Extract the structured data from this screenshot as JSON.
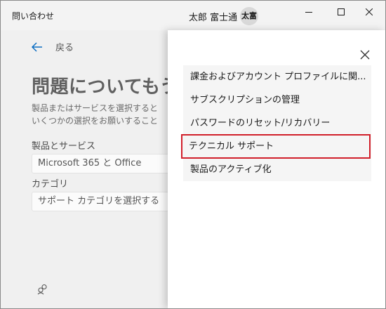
{
  "window": {
    "title": "問い合わせ",
    "user_name": "太郎 富士通",
    "avatar_initials": "太富"
  },
  "nav": {
    "back_label": "戻る"
  },
  "page": {
    "heading": "問題についてもう",
    "description_line1": "製品またはサービスを選択すると",
    "description_line2": "いくつかの選択をお願いすること",
    "product_label": "製品とサービス",
    "product_value": "Microsoft 365 と Office",
    "category_label": "カテゴリ",
    "category_placeholder": "サポート カテゴリを選択する"
  },
  "dropdown": {
    "items": [
      {
        "label": "課金およびアカウント プロファイルに関..."
      },
      {
        "label": "サブスクリプションの管理"
      },
      {
        "label": "パスワードのリセット/リカバリー"
      },
      {
        "label": "テクニカル サポート"
      },
      {
        "label": "製品のアクティブ化"
      }
    ],
    "highlighted_index": 3,
    "highlight_color": "#d11f2a"
  },
  "icons": {
    "back": "arrow-left-icon",
    "close_panel": "close-icon",
    "community": "community-icon",
    "minimize": "minimize-icon",
    "maximize": "maximize-icon",
    "close_window": "close-window-icon"
  },
  "colors": {
    "accent": "#0067c0",
    "panel_bg": "#ffffff",
    "page_bg": "#f0f0f0"
  }
}
